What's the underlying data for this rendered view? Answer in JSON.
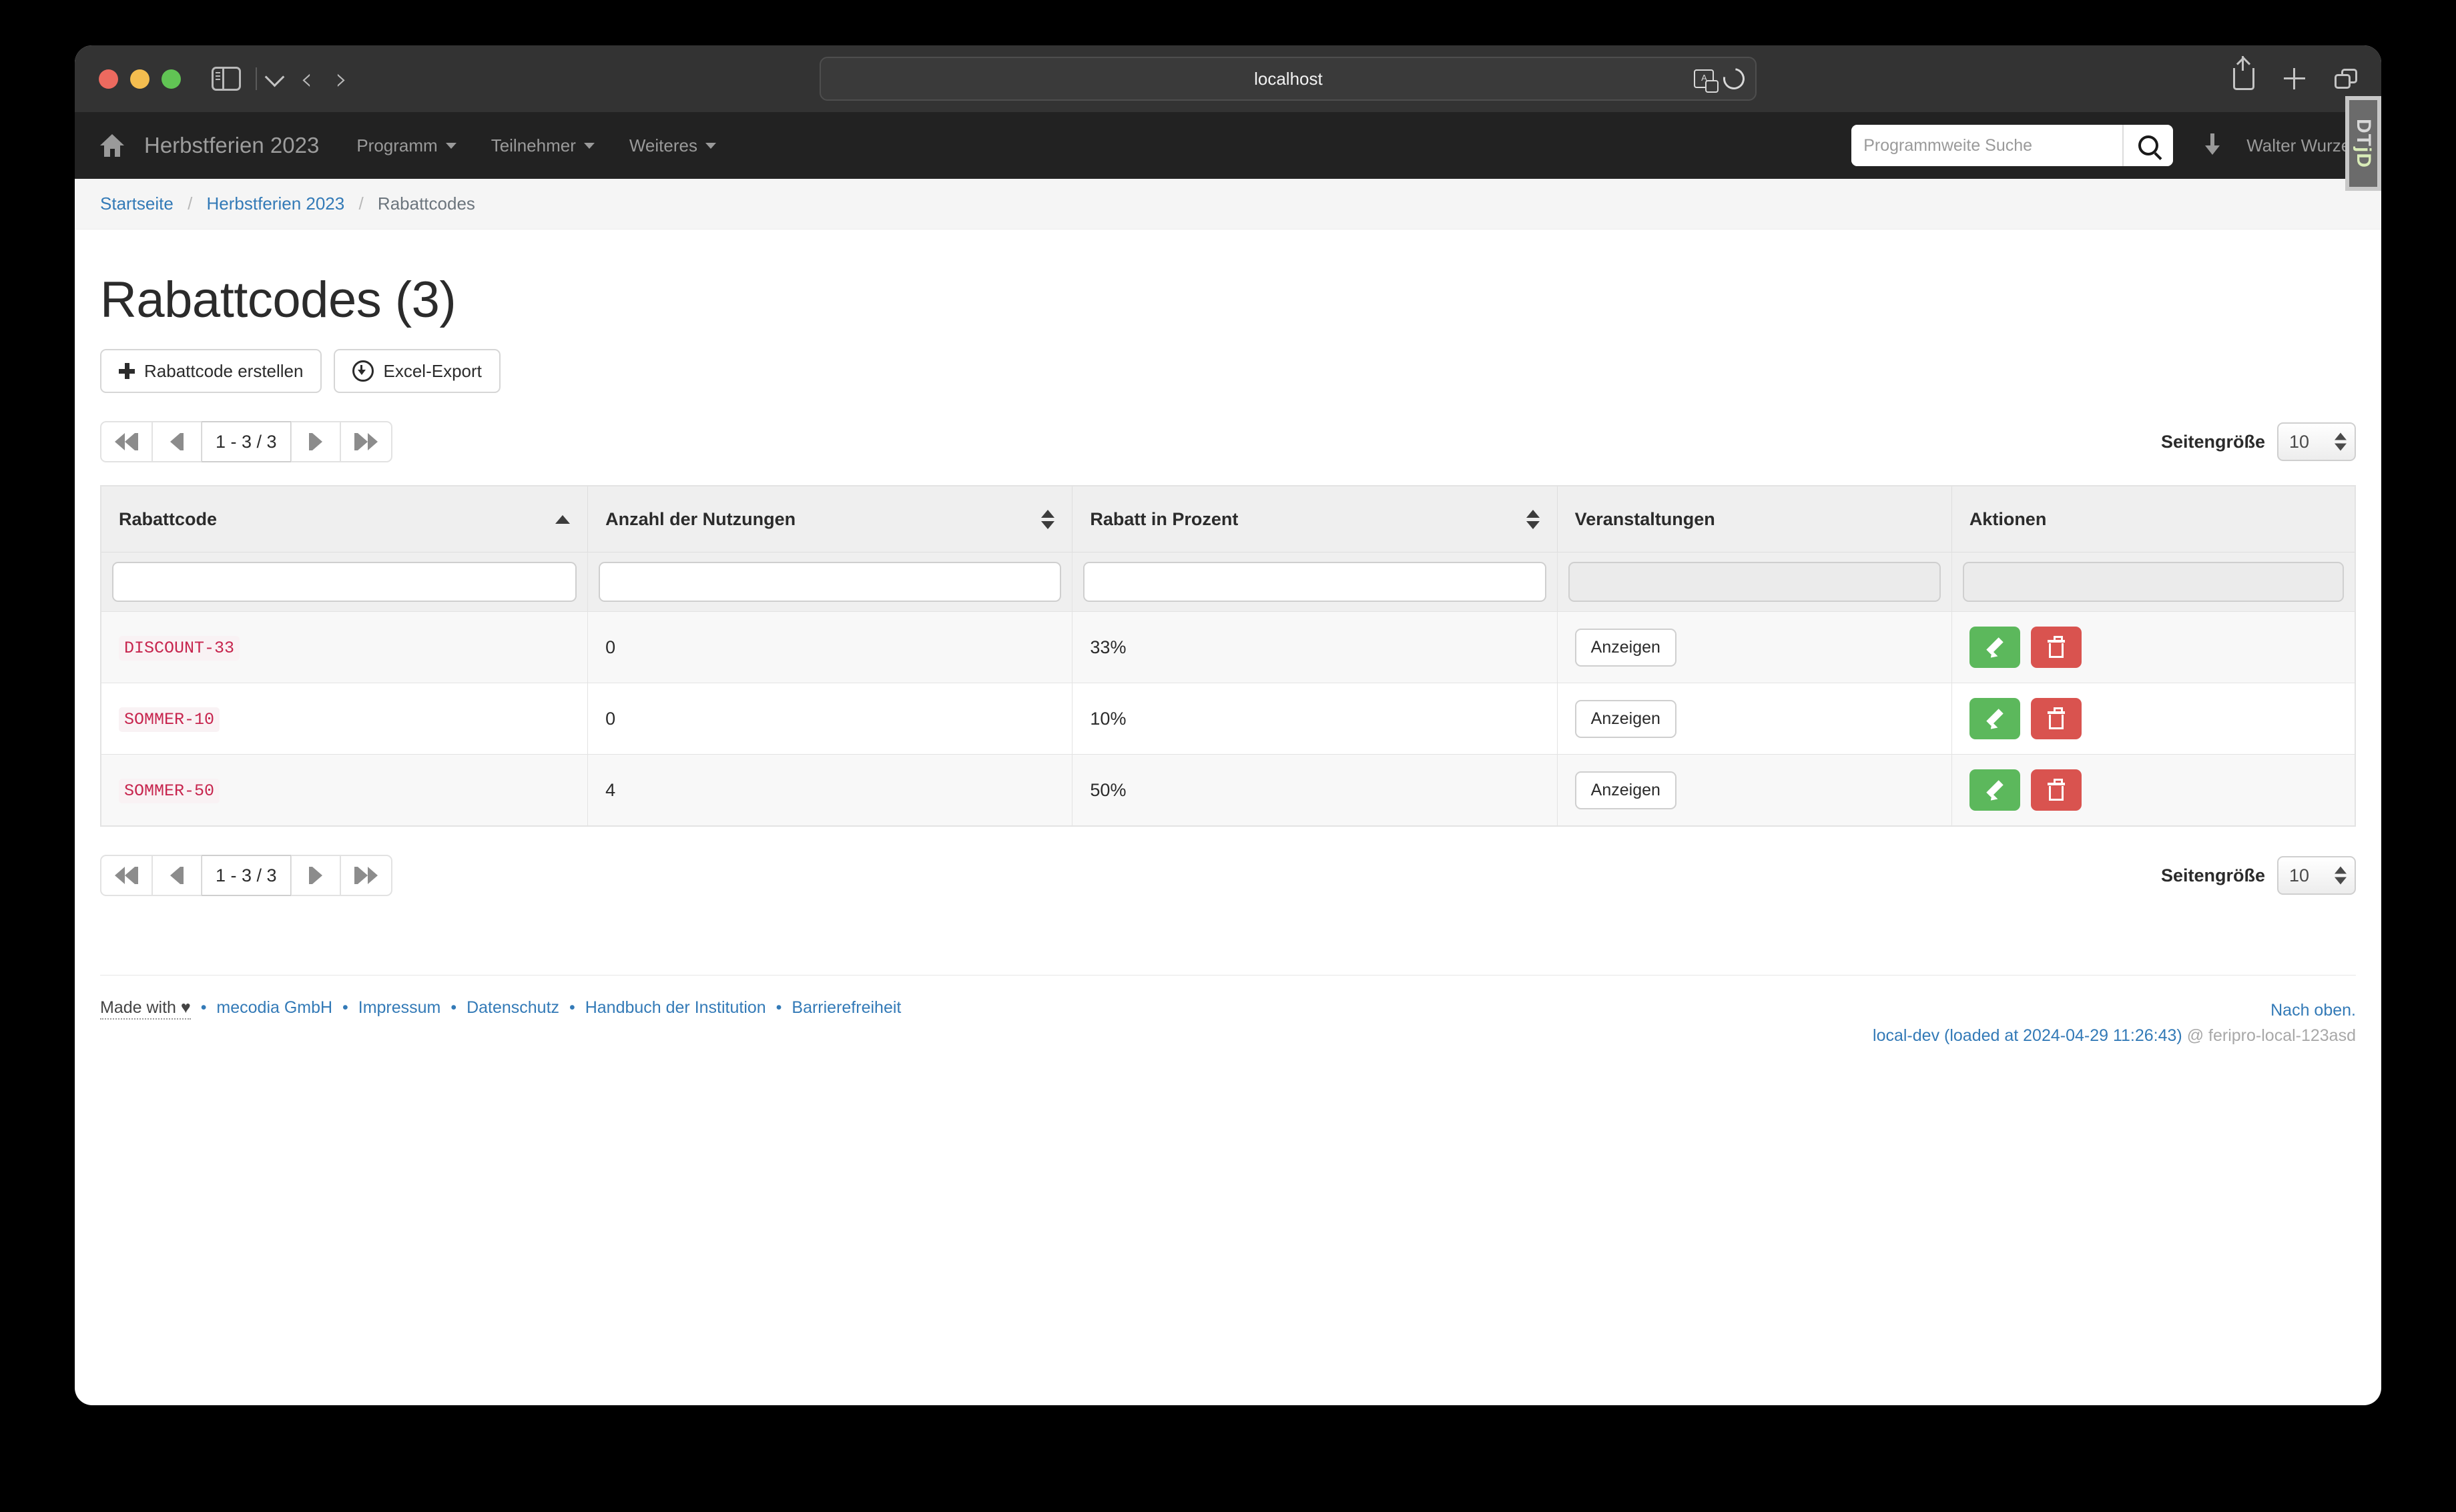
{
  "browser": {
    "url": "localhost",
    "icons": {
      "sidebar": "sidebar-icon",
      "dropdown": "chevron-down-icon",
      "back": "back-arrow-icon",
      "forward": "forward-arrow-icon",
      "translate": "translate-icon",
      "reload": "reload-icon",
      "share": "share-icon",
      "new_tab": "plus-icon",
      "tab_overview": "tabs-icon"
    }
  },
  "appnav": {
    "home_icon": "home-icon",
    "brand": "Herbstferien 2023",
    "links": [
      {
        "label": "Programm",
        "has_caret": true
      },
      {
        "label": "Teilnehmer",
        "has_caret": true
      },
      {
        "label": "Weiteres",
        "has_caret": true
      }
    ],
    "search": {
      "placeholder": "Programmweite Suche",
      "value": "",
      "button_icon": "search-icon"
    },
    "download_icon": "download-arrow-icon",
    "username": "Walter Wurzel",
    "debug_toolbar": {
      "label_top": "DT",
      "label_bottom": "Dj"
    }
  },
  "breadcrumb": {
    "items": [
      "Startseite",
      "Herbstferien 2023",
      "Rabattcodes"
    ],
    "separator": "/"
  },
  "page": {
    "title": "Rabattcodes (3)",
    "actions": [
      {
        "label": "Rabattcode erstellen",
        "icon": "plus-icon"
      },
      {
        "label": "Excel-Export",
        "icon": "download-circle-icon"
      }
    ]
  },
  "pagination": {
    "first_icon": "first-page-icon",
    "prev_icon": "prev-page-icon",
    "range": "1 - 3 / 3",
    "next_icon": "next-page-icon",
    "last_icon": "last-page-icon",
    "pagesize_label": "Seitengröße",
    "pagesize_value": "10"
  },
  "table": {
    "columns": [
      {
        "label": "Rabattcode",
        "sort": "asc"
      },
      {
        "label": "Anzahl der Nutzungen",
        "sort": "none"
      },
      {
        "label": "Rabatt in Prozent",
        "sort": "none"
      },
      {
        "label": "Veranstaltungen",
        "sort": null
      },
      {
        "label": "Aktionen",
        "sort": null
      }
    ],
    "filters": [
      {
        "value": "",
        "disabled": false
      },
      {
        "value": "",
        "disabled": false
      },
      {
        "value": "",
        "disabled": false
      },
      {
        "value": "",
        "disabled": true
      },
      {
        "value": "",
        "disabled": true
      }
    ],
    "rows": [
      {
        "code": "DISCOUNT-33",
        "usages": "0",
        "percent": "33%",
        "events_button": "Anzeigen",
        "edit_icon": "pencil-icon",
        "delete_icon": "trash-icon"
      },
      {
        "code": "SOMMER-10",
        "usages": "0",
        "percent": "10%",
        "events_button": "Anzeigen",
        "edit_icon": "pencil-icon",
        "delete_icon": "trash-icon"
      },
      {
        "code": "SOMMER-50",
        "usages": "4",
        "percent": "50%",
        "events_button": "Anzeigen",
        "edit_icon": "pencil-icon",
        "delete_icon": "trash-icon"
      }
    ]
  },
  "footer": {
    "made_with": "Made with ♥",
    "links": [
      "mecodia GmbH",
      "Impressum",
      "Datenschutz",
      "Handbuch der Institution",
      "Barrierefreiheit"
    ],
    "separator": "•",
    "back_to_top": "Nach oben.",
    "build": "local-dev (loaded at 2024-04-29 11:26:43)",
    "host": "@ feripro-local-123asd"
  },
  "colors": {
    "navbar_bg": "#222222",
    "toolbar_bg": "#333333",
    "link": "#337ab7",
    "code_text": "#c7254e",
    "code_bg": "#f9f2f4",
    "edit_green": "#5cb85c",
    "delete_red": "#d9534f"
  }
}
